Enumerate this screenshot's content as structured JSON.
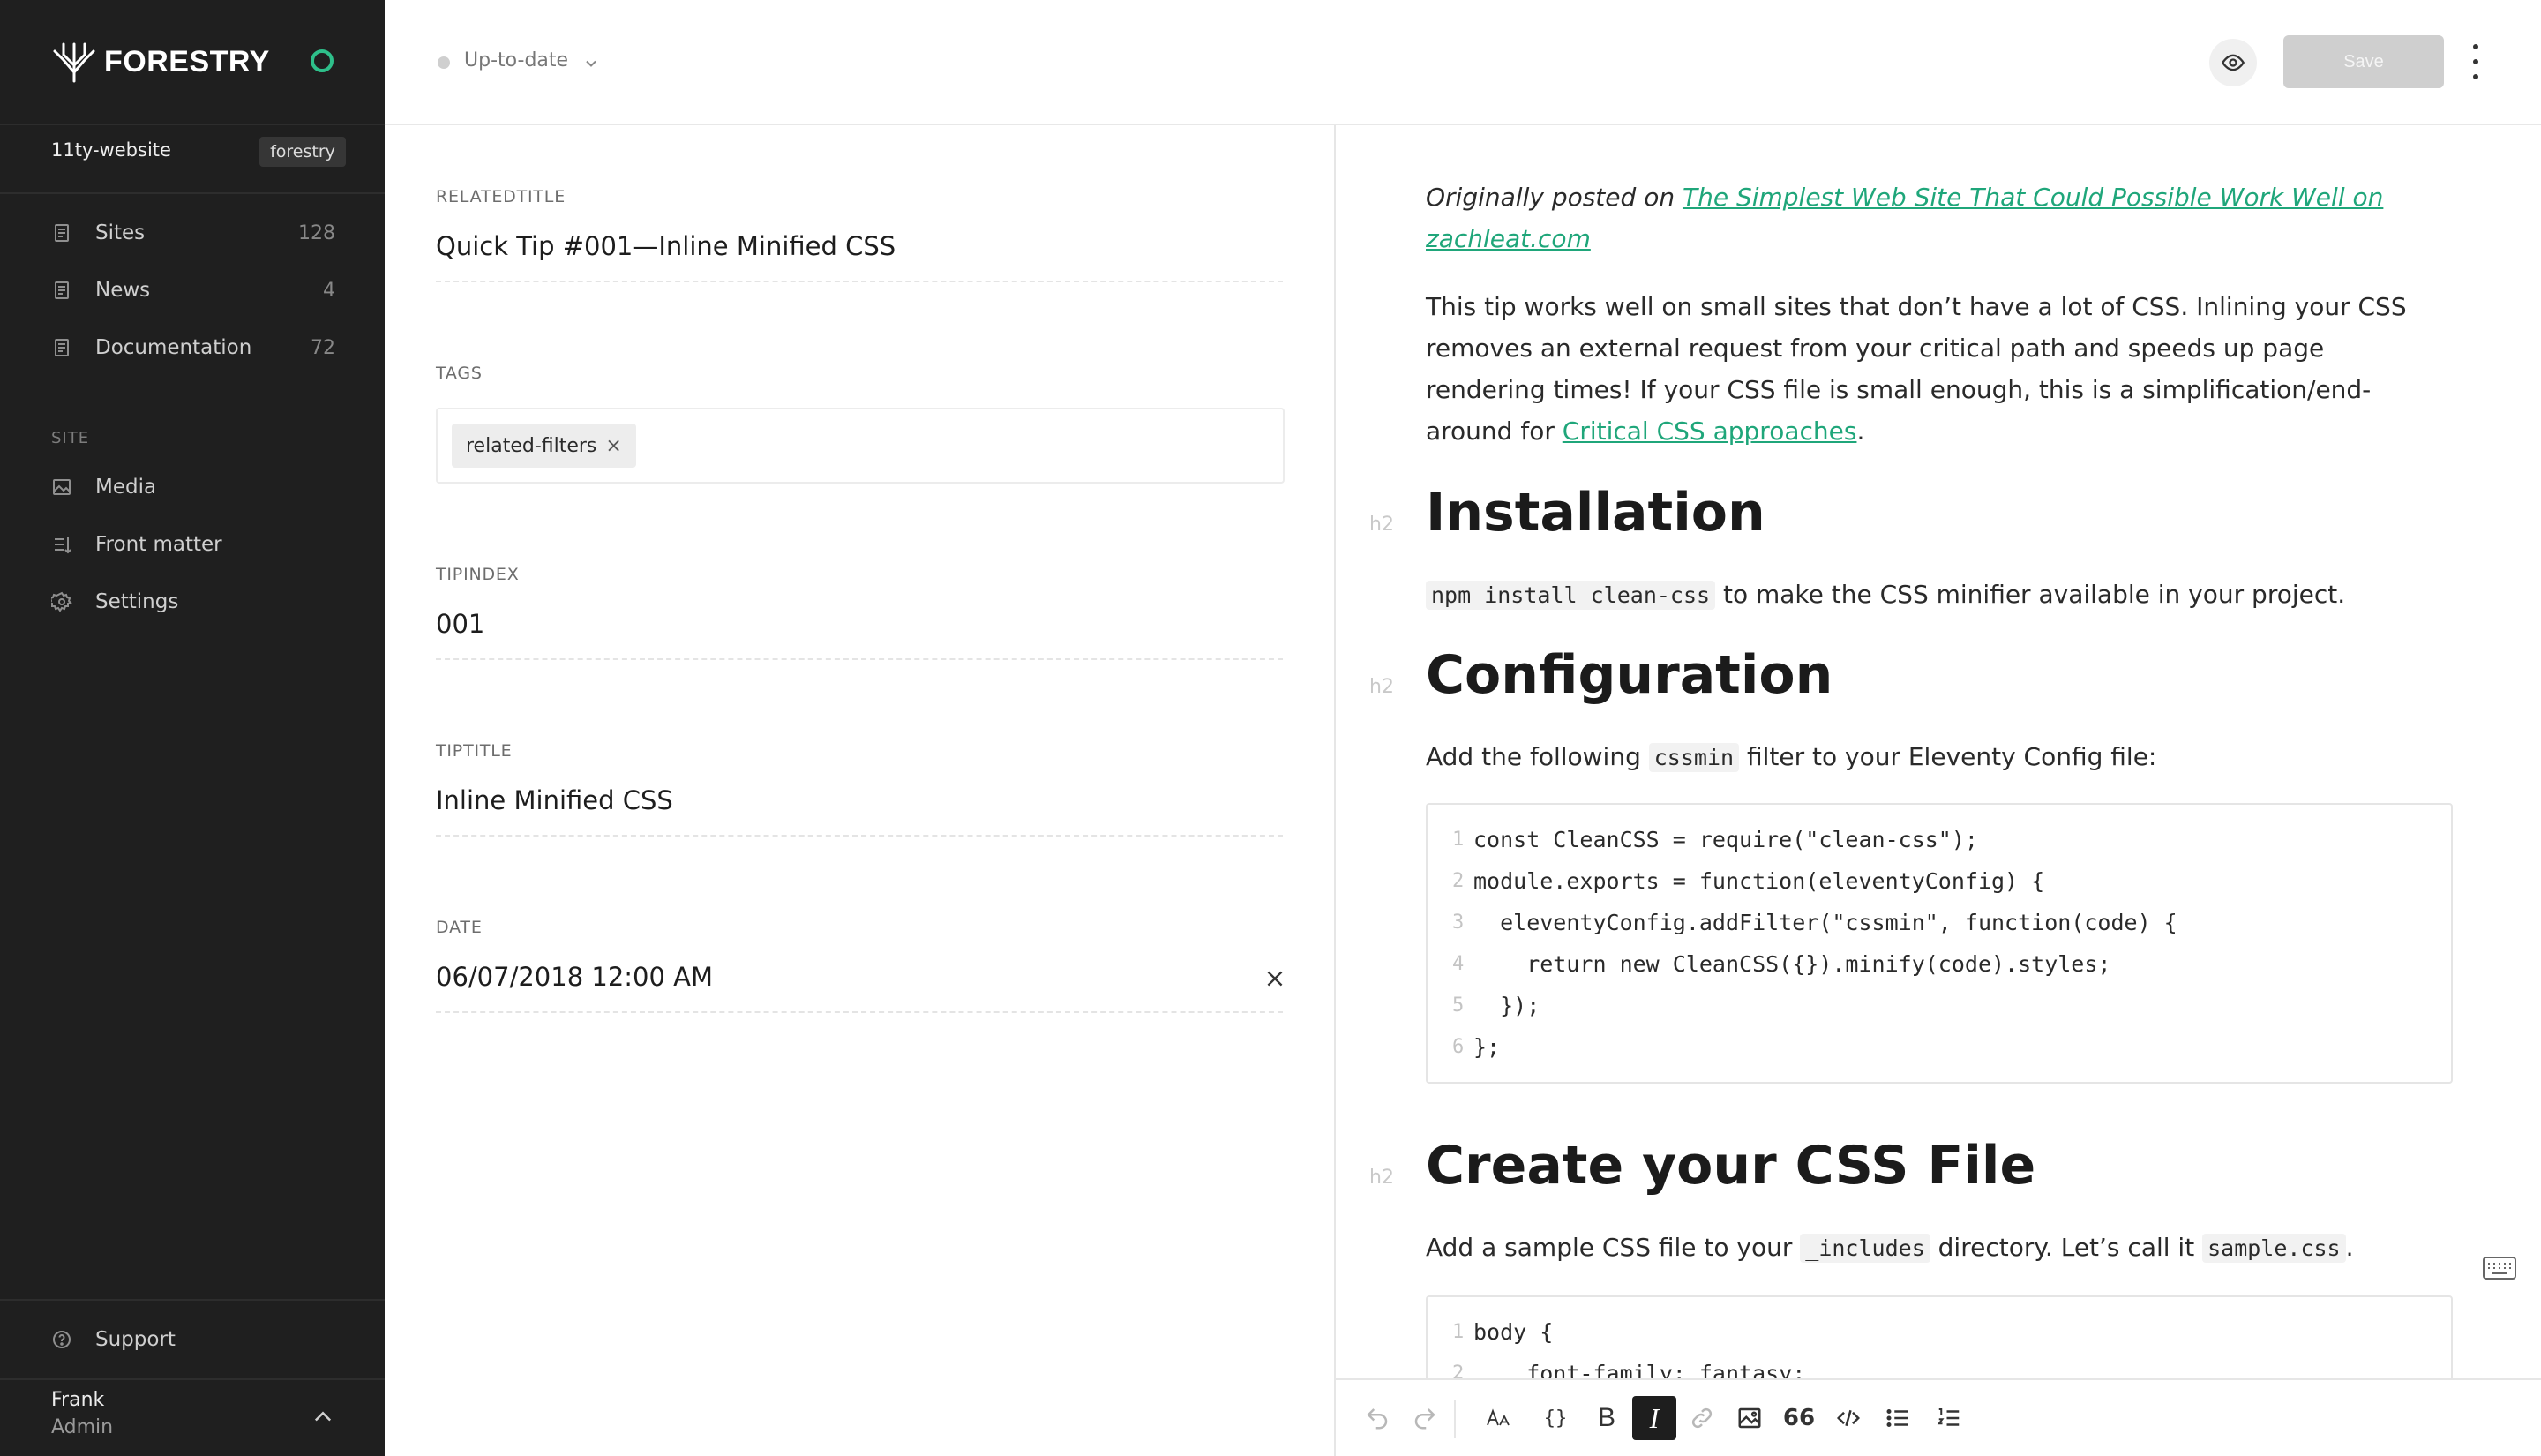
{
  "brand": {
    "name": "FORESTRY",
    "accent": "#2ebf8a"
  },
  "site": {
    "name": "11ty-website",
    "badge": "forestry"
  },
  "sidebar": {
    "items": [
      {
        "label": "Sites",
        "count": "128",
        "icon": "document-icon"
      },
      {
        "label": "News",
        "count": "4",
        "icon": "document-icon"
      },
      {
        "label": "Documentation",
        "count": "72",
        "icon": "document-icon"
      }
    ],
    "section_label": "SITE",
    "site_items": [
      {
        "label": "Media",
        "icon": "image-icon"
      },
      {
        "label": "Front matter",
        "icon": "sliders-icon"
      },
      {
        "label": "Settings",
        "icon": "gear-icon"
      }
    ],
    "support": "Support",
    "user": {
      "name": "Frank",
      "role": "Admin"
    }
  },
  "topbar": {
    "status": "Up-to-date",
    "save_label": "Save"
  },
  "form": {
    "fields": [
      {
        "label": "RELATEDTITLE",
        "value": "Quick Tip #001—Inline Minified CSS"
      },
      {
        "label": "TAGS",
        "tags": [
          "related-filters"
        ]
      },
      {
        "label": "TIPINDEX",
        "value": "001"
      },
      {
        "label": "TIPTITLE",
        "value": "Inline Minified CSS"
      },
      {
        "label": "DATE",
        "value": "06/07/2018 12:00 AM"
      }
    ],
    "tag_remove": "×"
  },
  "editor": {
    "intro": {
      "prefix": "Originally posted on ",
      "link": "The Simplest Web Site That Could Possible Work Well on zachleat.com"
    },
    "para1": {
      "text": "This tip works well on small sites that don’t have a lot of CSS. Inlining your CSS removes an external request from your critical path and speeds up page rendering times! If your CSS file is small enough, this is a simplification/end-around for ",
      "link": "Critical CSS approaches",
      "suffix": "."
    },
    "h2_tag": "h2",
    "sections": [
      {
        "heading": "Installation"
      },
      {
        "heading": "Configuration"
      },
      {
        "heading": "Create your CSS File"
      }
    ],
    "install": {
      "code": "npm install clean-css",
      "text": " to make the CSS minifier available in your project."
    },
    "config": {
      "prefix": "Add the following ",
      "code": "cssmin",
      "suffix": " filter to your Eleventy Config file:"
    },
    "code1": [
      {
        "n": "1",
        "t": "const CleanCSS = require(\"clean-css\");"
      },
      {
        "n": "2",
        "t": "module.exports = function(eleventyConfig) {"
      },
      {
        "n": "3",
        "t": "  eleventyConfig.addFilter(\"cssmin\", function(code) {"
      },
      {
        "n": "4",
        "t": "    return new CleanCSS({}).minify(code).styles;"
      },
      {
        "n": "5",
        "t": "  });"
      },
      {
        "n": "6",
        "t": "};"
      }
    ],
    "create": {
      "prefix": "Add a sample CSS file to your ",
      "code1": "_includes",
      "mid": " directory. Let’s call it ",
      "code2": "sample.css",
      "suffix": "."
    },
    "code2": [
      {
        "n": "1",
        "t": "body {"
      },
      {
        "n": "2",
        "t": "    font-family: fantasy;"
      }
    ]
  },
  "toolbar": {
    "buttons": [
      "undo-icon",
      "redo-icon",
      "text-size-icon",
      "braces-icon",
      "bold-icon",
      "italic-icon",
      "link-icon",
      "image-icon",
      "quote-icon",
      "code-icon",
      "bullet-list-icon",
      "numbered-list-icon"
    ],
    "bold": "B",
    "italic": "I",
    "braces": "{}",
    "quote": "66"
  }
}
